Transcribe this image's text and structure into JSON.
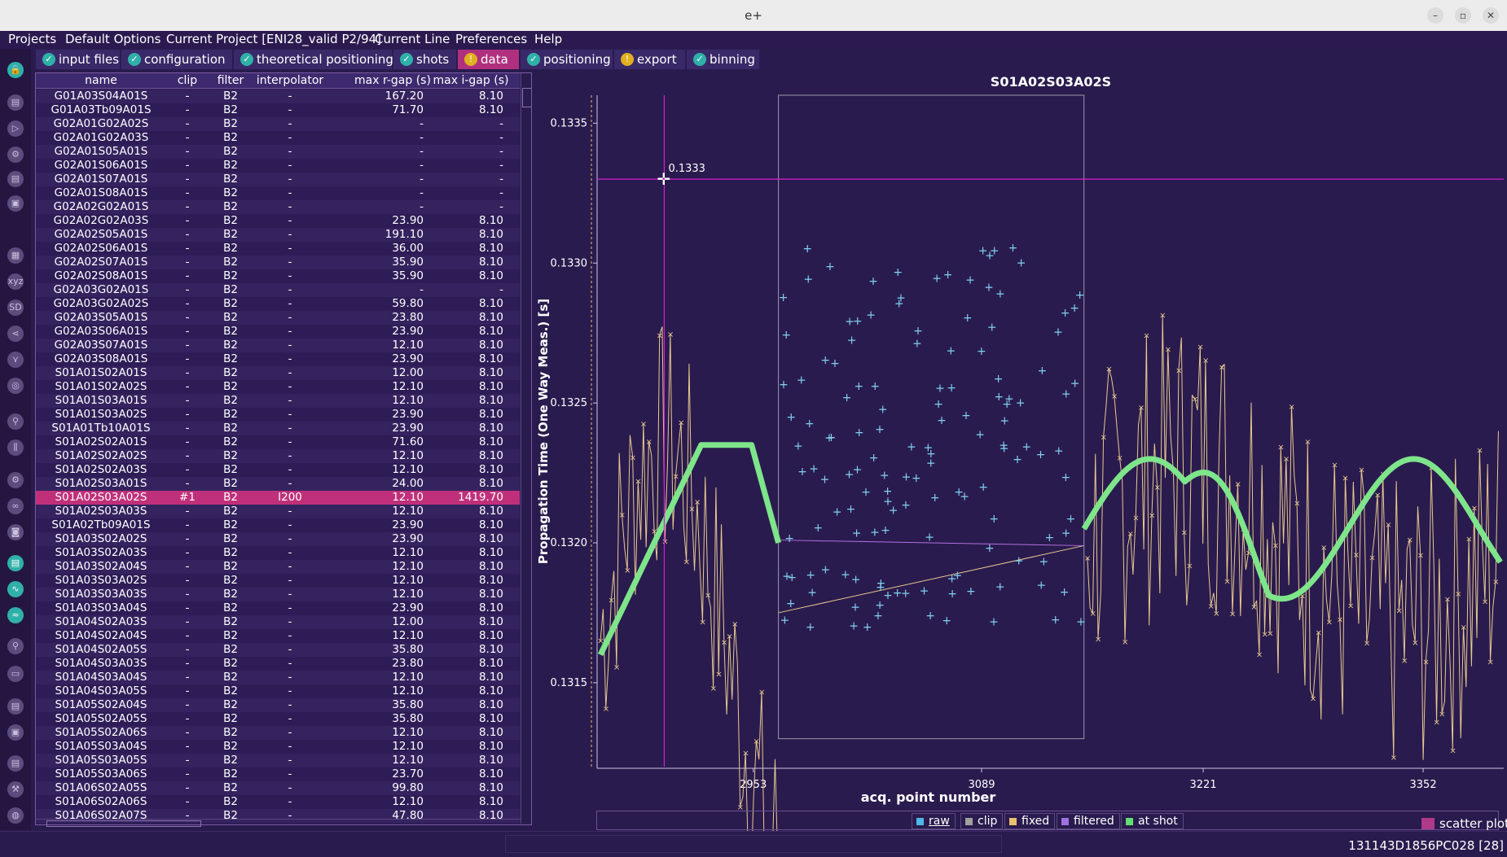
{
  "window": {
    "title": "e+"
  },
  "menu": [
    "Projects",
    "Default Options",
    "Current Project [ENI28_valid P2/94]",
    "Current Line",
    "Preferences",
    "Help"
  ],
  "tabs": [
    {
      "label": "input files",
      "status": "ok"
    },
    {
      "label": "configuration",
      "status": "ok"
    },
    {
      "label": "theoretical positioning",
      "status": "ok"
    },
    {
      "label": "shots",
      "status": "ok"
    },
    {
      "label": "data",
      "status": "warn",
      "active": true
    },
    {
      "label": "positioning",
      "status": "ok"
    },
    {
      "label": "export",
      "status": "warn"
    },
    {
      "label": "binning",
      "status": "ok"
    }
  ],
  "table": {
    "columns": [
      "name",
      "clip",
      "filter",
      "interpolator",
      "max r-gap (s)",
      "max i-gap (s)"
    ],
    "rows": [
      [
        "G01A03S04A01S",
        "-",
        "B2",
        "-",
        "167.20",
        "8.10"
      ],
      [
        "G01A03Tb09A01S",
        "-",
        "B2",
        "-",
        "71.70",
        "8.10"
      ],
      [
        "G02A01G02A02S",
        "-",
        "B2",
        "-",
        "-",
        "-"
      ],
      [
        "G02A01G02A03S",
        "-",
        "B2",
        "-",
        "-",
        "-"
      ],
      [
        "G02A01S05A01S",
        "-",
        "B2",
        "-",
        "-",
        "-"
      ],
      [
        "G02A01S06A01S",
        "-",
        "B2",
        "-",
        "-",
        "-"
      ],
      [
        "G02A01S07A01S",
        "-",
        "B2",
        "-",
        "-",
        "-"
      ],
      [
        "G02A01S08A01S",
        "-",
        "B2",
        "-",
        "-",
        "-"
      ],
      [
        "G02A02G02A01S",
        "-",
        "B2",
        "-",
        "-",
        "-"
      ],
      [
        "G02A02G02A03S",
        "-",
        "B2",
        "-",
        "23.90",
        "8.10"
      ],
      [
        "G02A02S05A01S",
        "-",
        "B2",
        "-",
        "191.10",
        "8.10"
      ],
      [
        "G02A02S06A01S",
        "-",
        "B2",
        "-",
        "36.00",
        "8.10"
      ],
      [
        "G02A02S07A01S",
        "-",
        "B2",
        "-",
        "35.90",
        "8.10"
      ],
      [
        "G02A02S08A01S",
        "-",
        "B2",
        "-",
        "35.90",
        "8.10"
      ],
      [
        "G02A03G02A01S",
        "-",
        "B2",
        "-",
        "-",
        "-"
      ],
      [
        "G02A03G02A02S",
        "-",
        "B2",
        "-",
        "59.80",
        "8.10"
      ],
      [
        "G02A03S05A01S",
        "-",
        "B2",
        "-",
        "23.80",
        "8.10"
      ],
      [
        "G02A03S06A01S",
        "-",
        "B2",
        "-",
        "23.90",
        "8.10"
      ],
      [
        "G02A03S07A01S",
        "-",
        "B2",
        "-",
        "12.10",
        "8.10"
      ],
      [
        "G02A03S08A01S",
        "-",
        "B2",
        "-",
        "23.90",
        "8.10"
      ],
      [
        "S01A01S02A01S",
        "-",
        "B2",
        "-",
        "12.00",
        "8.10"
      ],
      [
        "S01A01S02A02S",
        "-",
        "B2",
        "-",
        "12.10",
        "8.10"
      ],
      [
        "S01A01S03A01S",
        "-",
        "B2",
        "-",
        "12.10",
        "8.10"
      ],
      [
        "S01A01S03A02S",
        "-",
        "B2",
        "-",
        "23.90",
        "8.10"
      ],
      [
        "S01A01Tb10A01S",
        "-",
        "B2",
        "-",
        "23.90",
        "8.10"
      ],
      [
        "S01A02S02A01S",
        "-",
        "B2",
        "-",
        "71.60",
        "8.10"
      ],
      [
        "S01A02S02A02S",
        "-",
        "B2",
        "-",
        "12.10",
        "8.10"
      ],
      [
        "S01A02S02A03S",
        "-",
        "B2",
        "-",
        "12.10",
        "8.10"
      ],
      [
        "S01A02S03A01S",
        "-",
        "B2",
        "-",
        "24.00",
        "8.10"
      ],
      [
        "S01A02S03A02S",
        "#1",
        "B2",
        "I200",
        "12.10",
        "1419.70"
      ],
      [
        "S01A02S03A03S",
        "-",
        "B2",
        "-",
        "12.10",
        "8.10"
      ],
      [
        "S01A02Tb09A01S",
        "-",
        "B2",
        "-",
        "23.90",
        "8.10"
      ],
      [
        "S01A03S02A02S",
        "-",
        "B2",
        "-",
        "23.90",
        "8.10"
      ],
      [
        "S01A03S02A03S",
        "-",
        "B2",
        "-",
        "12.10",
        "8.10"
      ],
      [
        "S01A03S02A04S",
        "-",
        "B2",
        "-",
        "12.10",
        "8.10"
      ],
      [
        "S01A03S03A02S",
        "-",
        "B2",
        "-",
        "12.10",
        "8.10"
      ],
      [
        "S01A03S03A03S",
        "-",
        "B2",
        "-",
        "12.10",
        "8.10"
      ],
      [
        "S01A03S03A04S",
        "-",
        "B2",
        "-",
        "23.90",
        "8.10"
      ],
      [
        "S01A04S02A03S",
        "-",
        "B2",
        "-",
        "12.00",
        "8.10"
      ],
      [
        "S01A04S02A04S",
        "-",
        "B2",
        "-",
        "12.10",
        "8.10"
      ],
      [
        "S01A04S02A05S",
        "-",
        "B2",
        "-",
        "35.80",
        "8.10"
      ],
      [
        "S01A04S03A03S",
        "-",
        "B2",
        "-",
        "23.80",
        "8.10"
      ],
      [
        "S01A04S03A04S",
        "-",
        "B2",
        "-",
        "12.10",
        "8.10"
      ],
      [
        "S01A04S03A05S",
        "-",
        "B2",
        "-",
        "12.10",
        "8.10"
      ],
      [
        "S01A05S02A04S",
        "-",
        "B2",
        "-",
        "35.80",
        "8.10"
      ],
      [
        "S01A05S02A05S",
        "-",
        "B2",
        "-",
        "35.80",
        "8.10"
      ],
      [
        "S01A05S02A06S",
        "-",
        "B2",
        "-",
        "12.10",
        "8.10"
      ],
      [
        "S01A05S03A04S",
        "-",
        "B2",
        "-",
        "12.10",
        "8.10"
      ],
      [
        "S01A05S03A05S",
        "-",
        "B2",
        "-",
        "12.10",
        "8.10"
      ],
      [
        "S01A05S03A06S",
        "-",
        "B2",
        "-",
        "23.70",
        "8.10"
      ],
      [
        "S01A06S02A05S",
        "-",
        "B2",
        "-",
        "99.80",
        "8.10"
      ],
      [
        "S01A06S02A06S",
        "-",
        "B2",
        "-",
        "12.10",
        "8.10"
      ],
      [
        "S01A06S02A07S",
        "-",
        "B2",
        "-",
        "47.80",
        "8.10"
      ]
    ],
    "selected_index": 29
  },
  "chart_data": {
    "type": "scatter",
    "title": "S01A02S03A02S",
    "xlabel": "acq. point number",
    "ylabel": "Propagation Time (One Way Meas.) [s]",
    "x_ticks": [
      2953,
      3089,
      3221,
      3352
    ],
    "y_ticks": [
      0.1315,
      0.132,
      0.1325,
      0.133,
      0.1335
    ],
    "xlim": [
      2860,
      3400
    ],
    "ylim": [
      0.1312,
      0.1336
    ],
    "cursor": {
      "x": 2900,
      "y": 0.1333,
      "label": "0.1333"
    },
    "clip_box": {
      "x0": 2968,
      "x1": 3150,
      "y0": 0.1313,
      "y1": 0.1336
    },
    "series": [
      {
        "name": "raw",
        "color": "#7fd0f0",
        "marker": "+"
      },
      {
        "name": "clip",
        "color": "#9a9aaa"
      },
      {
        "name": "fixed",
        "color": "#e8c890",
        "marker": "x"
      },
      {
        "name": "filtered",
        "color": "#b070e0"
      },
      {
        "name": "at shot",
        "color": "#7ee58a"
      }
    ],
    "legend_placement": "bottom"
  },
  "legend": {
    "items": [
      {
        "label": "raw",
        "color": "#4fb8e8"
      },
      {
        "label": "clip",
        "color": "#a0a0a0"
      },
      {
        "label": "fixed",
        "color": "#e8c070"
      },
      {
        "label": "filtered",
        "color": "#a070e0"
      },
      {
        "label": "at shot",
        "color": "#60e070"
      }
    ],
    "scatter_label": "scatter plot"
  },
  "status": {
    "text": "131143D1856PC028 [28]"
  },
  "colors": {
    "background": "#2a1b4e",
    "selected_row": "#c0307a",
    "active_tab": "#b0307f",
    "ok_badge": "#2fb0a8",
    "warn_badge": "#e0b020"
  }
}
